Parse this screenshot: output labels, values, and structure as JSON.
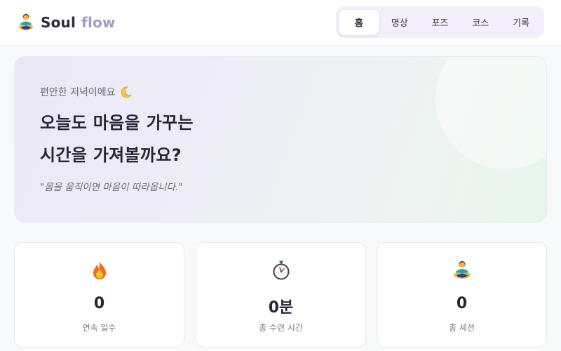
{
  "header": {
    "logo_primary": "Soul",
    "logo_secondary": "flow",
    "logo_icon": "meditating-person-icon",
    "nav": [
      {
        "label": "홈",
        "active": true
      },
      {
        "label": "명상",
        "active": false
      },
      {
        "label": "포즈",
        "active": false
      },
      {
        "label": "코스",
        "active": false
      },
      {
        "label": "기록",
        "active": false
      }
    ]
  },
  "hero": {
    "greeting": "편안한 저녁이에요",
    "greeting_icon": "crescent-moon-icon",
    "title_line1": "오늘도 마음을 가꾸는",
    "title_line2": "시간을 가져볼까요?",
    "quote": "\"몸을 움직이면 마음이 따라옵니다.\""
  },
  "stats": [
    {
      "icon": "fire-icon",
      "value": "0",
      "label": "연속 일수"
    },
    {
      "icon": "stopwatch-icon",
      "value": "0분",
      "label": "총 수련 시간"
    },
    {
      "icon": "meditating-person-icon",
      "value": "0",
      "label": "총 세션"
    }
  ],
  "colors": {
    "accent": "#a79bc8",
    "nav_bg": "#f3f0fb",
    "background": "#f8f9fb"
  }
}
